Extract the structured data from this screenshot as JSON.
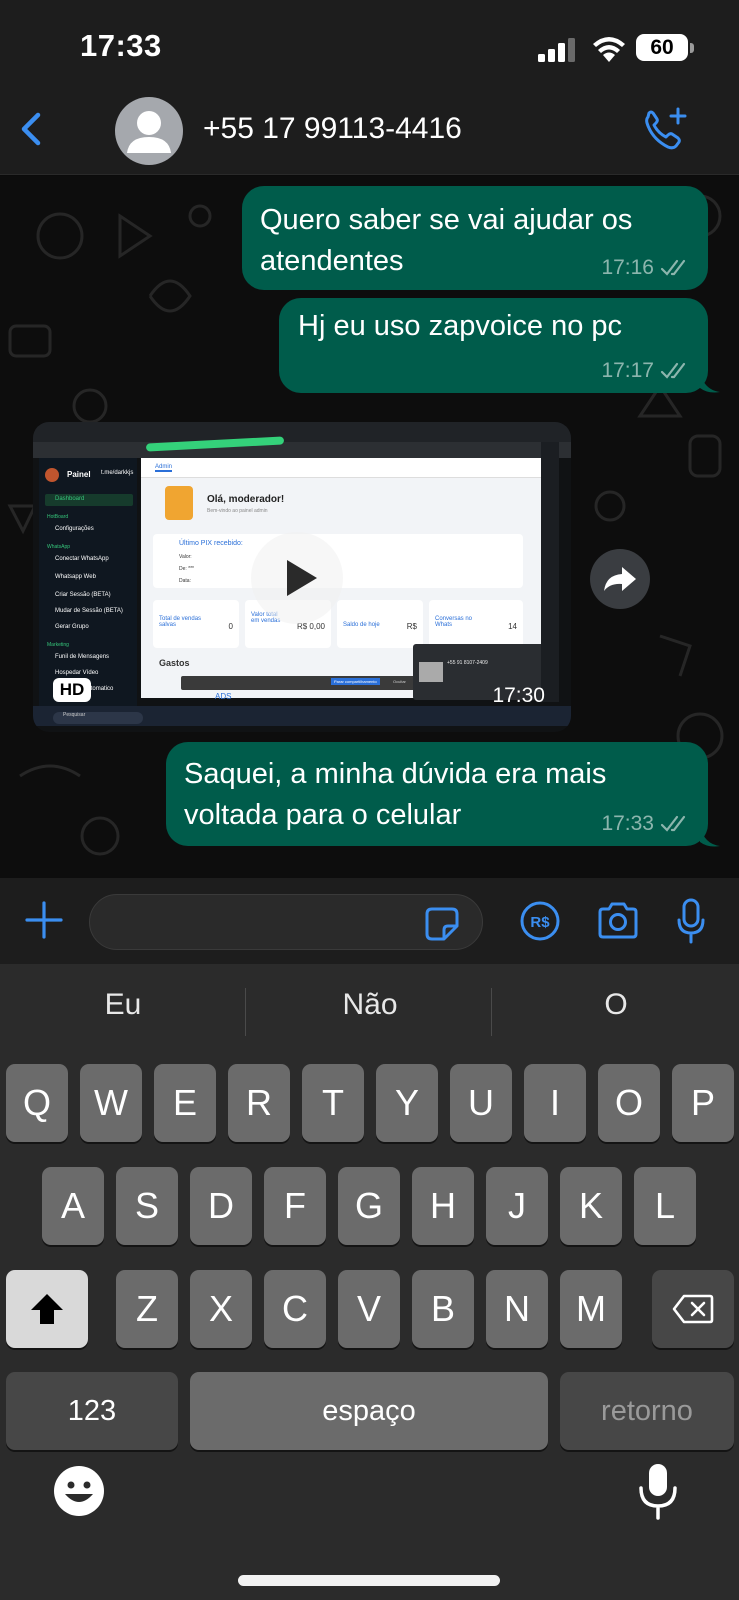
{
  "status_bar": {
    "time": "17:33",
    "battery": "60"
  },
  "header": {
    "contact": "+55 17 99113-4416",
    "back_icon": "chevron-left-icon",
    "call_icon": "phone-add-icon"
  },
  "messages": [
    {
      "text": "Quero saber se vai ajudar os atendentes",
      "time": "17:16",
      "status": "read"
    },
    {
      "text": "Hj eu uso zapvoice no pc",
      "time": "17:17",
      "status": "read"
    },
    {
      "type": "video",
      "badge": "HD",
      "time": "17:30",
      "screenshot": {
        "sidebar_title": "Painel",
        "sidebar_user": "t.me/darkkjs",
        "tab": "Admin",
        "greeting": "Olá, moderador!",
        "greeting_sub": "Bem-vindo ao painel admin",
        "pix_title": "Último PIX recebido:",
        "pix_fields": [
          "Valor:",
          "De: ***",
          "Data:"
        ],
        "stats": [
          {
            "label": "Total de vendas salvas",
            "value": "0"
          },
          {
            "label": "Valor total em vendas",
            "value": "R$ 0,00"
          },
          {
            "label": "Saldo de hoje",
            "value": "R$"
          },
          {
            "label": "Conversas no Whats",
            "value": "14"
          }
        ],
        "expenses_title": "Gastos",
        "nav": [
          "Dashboard",
          "HotBoard",
          "Configurações",
          "WhatsApp",
          "Conectar WhatsApp",
          "Whatsapp Web",
          "Criar Sessão (BETA)",
          "Mudar de Sessão (BETA)",
          "Gerar Grupo",
          "Marketing",
          "Funil de Mensagens",
          "Hospedar Vídeo",
          "Postagem Automatico"
        ],
        "notification_number": "+55 91 8107-2409",
        "search_placeholder": "Pesquisar",
        "share_button": "Parar compartilhamento",
        "hide_button": "Ocultar",
        "ads_label": "ADS"
      }
    },
    {
      "text": "Saquei, a minha dúvida era mais voltada para o celular",
      "time": "17:33",
      "status": "read"
    }
  ],
  "input_bar": {
    "placeholder": ""
  },
  "keyboard": {
    "suggestions": [
      "Eu",
      "Não",
      "O"
    ],
    "row1": [
      "Q",
      "W",
      "E",
      "R",
      "T",
      "Y",
      "U",
      "I",
      "O",
      "P"
    ],
    "row2": [
      "A",
      "S",
      "D",
      "F",
      "G",
      "H",
      "J",
      "K",
      "L"
    ],
    "row3": [
      "Z",
      "X",
      "C",
      "V",
      "B",
      "N",
      "M"
    ],
    "numbers_key": "123",
    "space_key": "espaço",
    "return_key": "retorno"
  },
  "colors": {
    "bubble_outgoing": "#005c4b",
    "accent_blue": "#3b8ef0",
    "background": "#0b0b0b"
  }
}
